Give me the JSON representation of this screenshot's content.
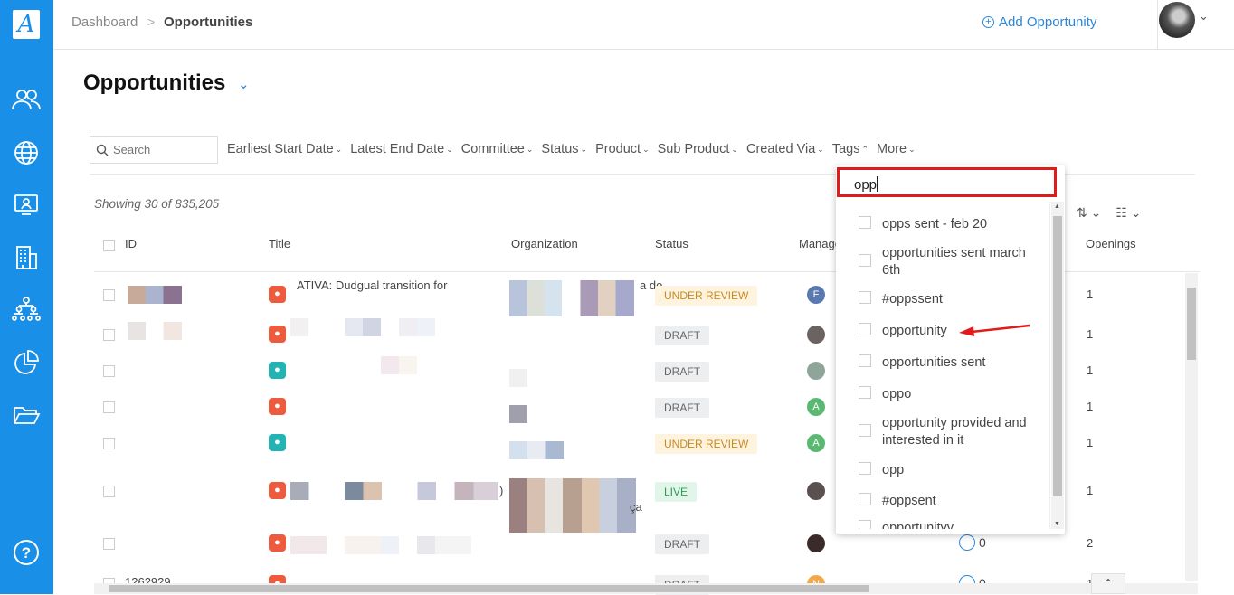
{
  "app": {
    "logo_letter": "A"
  },
  "sidebar": {
    "items": [
      {
        "icon": "people-icon"
      },
      {
        "icon": "globe-icon"
      },
      {
        "icon": "monitor-icon"
      },
      {
        "icon": "building-icon"
      },
      {
        "icon": "org-chart-icon"
      },
      {
        "icon": "pie-chart-icon"
      },
      {
        "icon": "folder-icon"
      },
      {
        "icon": "help-icon"
      }
    ],
    "help_label": "?"
  },
  "header": {
    "breadcrumb_root": "Dashboard",
    "breadcrumb_sep": ">",
    "breadcrumb_current": "Opportunities",
    "add_label": "Add Opportunity"
  },
  "page": {
    "title": "Opportunities"
  },
  "search": {
    "placeholder": "Search"
  },
  "filters": [
    "Earliest Start Date",
    "Latest End Date",
    "Committee",
    "Status",
    "Product",
    "Sub Product",
    "Created Via",
    "Tags",
    "More"
  ],
  "showing_text": "Showing 30 of 835,205",
  "table": {
    "columns": [
      "ID",
      "Title",
      "Organization",
      "Status",
      "Manage",
      "Openings"
    ],
    "rows": [
      {
        "id": "",
        "status": "UNDER REVIEW",
        "mgr_letter": "F",
        "openings": "1"
      },
      {
        "id": "",
        "status": "DRAFT",
        "mgr_letter": "",
        "openings": "1"
      },
      {
        "id": "",
        "status": "DRAFT",
        "mgr_letter": "",
        "openings": "1"
      },
      {
        "id": "",
        "status": "DRAFT",
        "mgr_letter": "A",
        "openings": "1"
      },
      {
        "id": "",
        "status": "UNDER REVIEW",
        "mgr_letter": "A",
        "openings": "1"
      },
      {
        "id": "",
        "status": "LIVE",
        "mgr_letter": "",
        "openings": "1"
      },
      {
        "id": "",
        "status": "DRAFT",
        "mgr_letter": "",
        "openings": "2"
      },
      {
        "id": "1262929",
        "status": "DRAFT",
        "mgr_letter": "N",
        "openings": "1"
      }
    ],
    "row7_applicants": "0",
    "row8_applicants": "0",
    "title_fragment_1": "ATIVA: Dudgual transition for",
    "org_fragment_1": "a do",
    "title_fragment_6": ")",
    "org_fragment_6": "ça"
  },
  "tags_dropdown": {
    "query": "opp",
    "options": [
      "opps sent - feb 20",
      "opportunities sent march 6th",
      "#oppssent",
      "opportunity",
      "opportunities sent",
      "oppo",
      "opportunity provided and interested in it",
      "opp",
      "#oppsent",
      "opportunityy"
    ]
  },
  "colors": {
    "brand": "#1a8fe8",
    "highlight": "#e01b1b"
  }
}
